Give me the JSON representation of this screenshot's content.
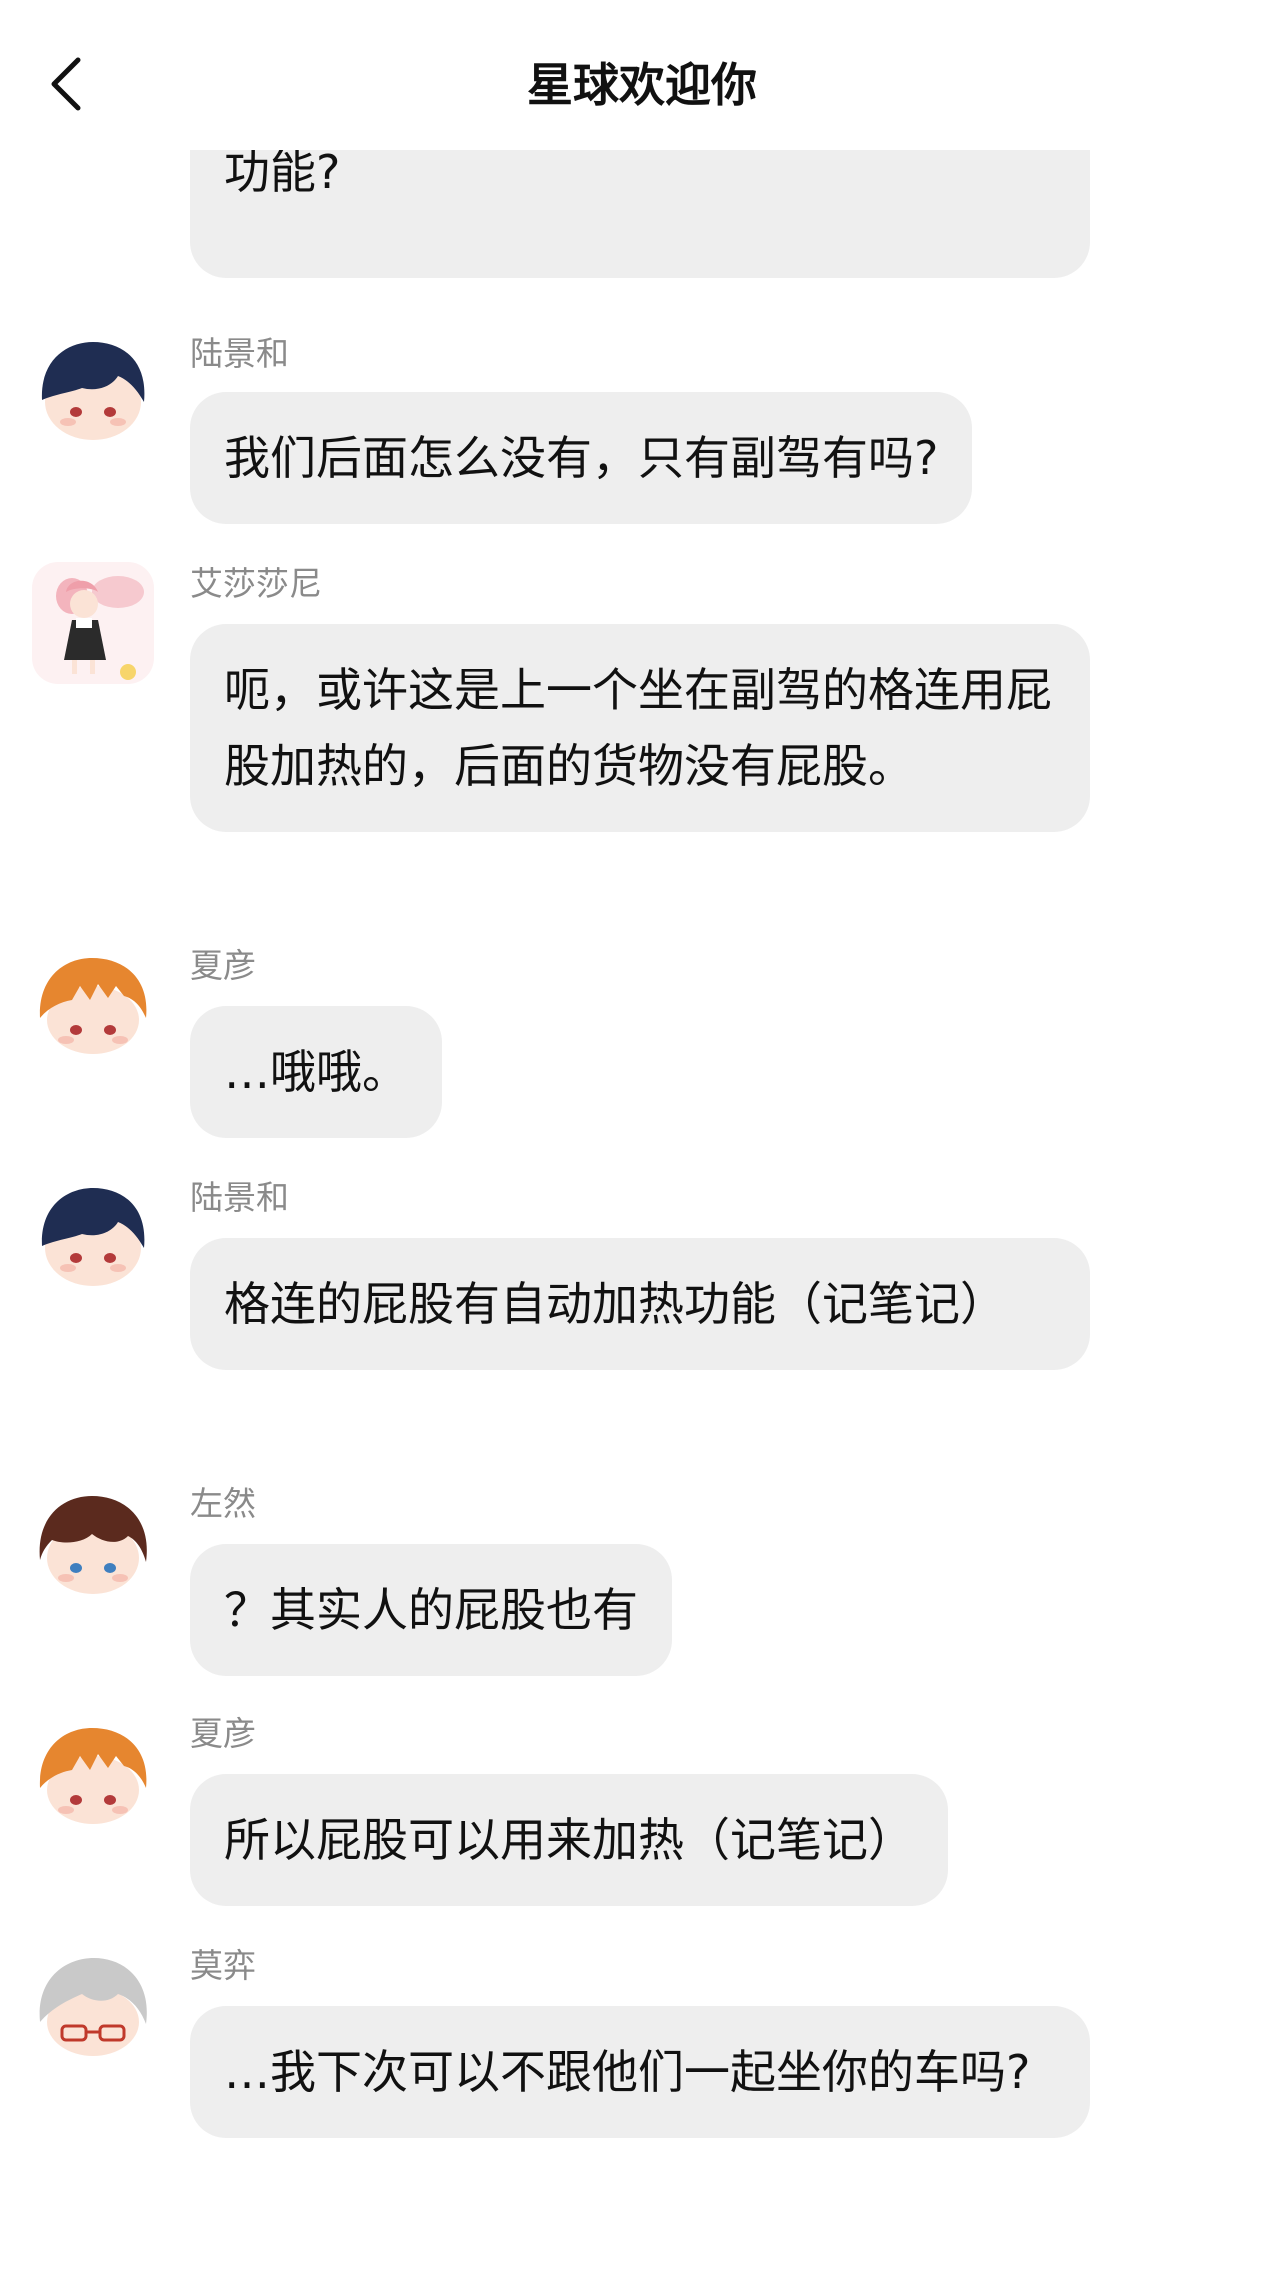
{
  "header": {
    "title": "星球欢迎你"
  },
  "messages": [
    {
      "sender": "",
      "avatar": "none",
      "text": "艾莎莎尼的车什么时候加了座椅自动加热功能?"
    },
    {
      "sender": "陆景和",
      "avatar": "navy-hair-chibi",
      "text": "我们后面怎么没有，只有副驾有吗?"
    },
    {
      "sender": "艾莎莎尼",
      "avatar": "pink-bunny-girl",
      "text": "呃，或许这是上一个坐在副驾的格连用屁股加热的，后面的货物没有屁股。"
    },
    {
      "sender": "夏彦",
      "avatar": "orange-hair-chibi",
      "text": "…哦哦。"
    },
    {
      "sender": "陆景和",
      "avatar": "navy-hair-chibi",
      "text": "格连的屁股有自动加热功能（记笔记）"
    },
    {
      "sender": "左然",
      "avatar": "brown-hair-chibi",
      "text": "？其实人的屁股也有"
    },
    {
      "sender": "夏彦",
      "avatar": "orange-hair-chibi",
      "text": "所以屁股可以用来加热（记笔记）"
    },
    {
      "sender": "莫弈",
      "avatar": "grey-hair-glasses-chibi",
      "text": "…我下次可以不跟他们一起坐你的车吗?"
    }
  ],
  "colors": {
    "bubble": "#eeeeee",
    "sender_name": "#8a8a8a",
    "background": "#ffffff"
  },
  "icons": {
    "back": "chevron-left-icon"
  }
}
